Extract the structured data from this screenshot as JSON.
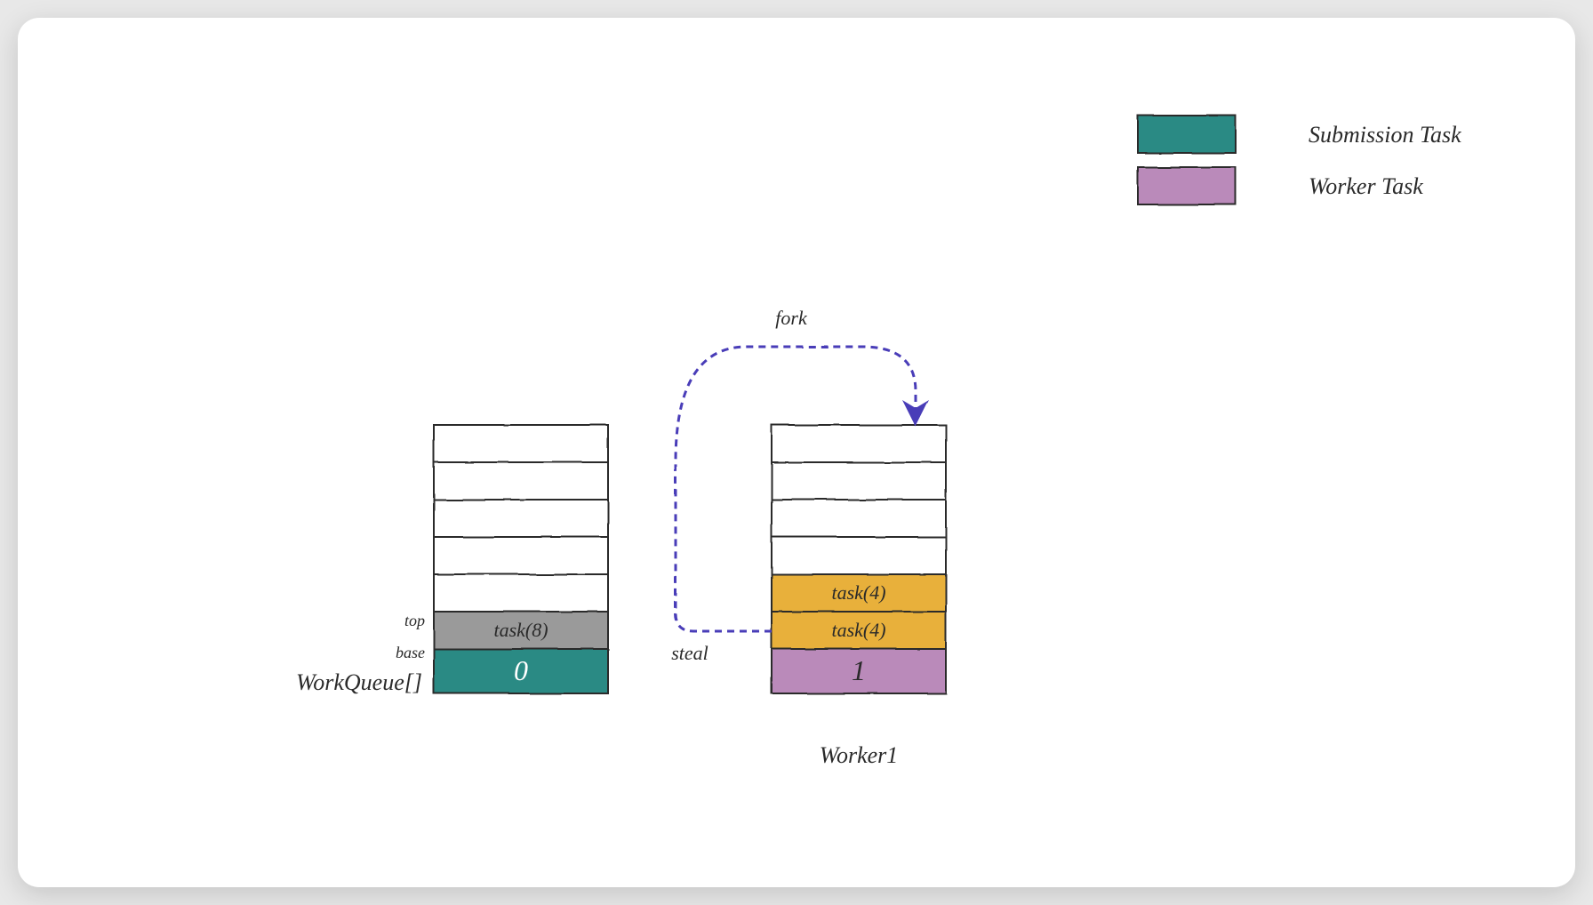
{
  "legend": {
    "item1": {
      "label": "Submission Task",
      "color": "#2b8a84"
    },
    "item2": {
      "label": "Worker Task",
      "color": "#ba8aba"
    }
  },
  "arrows": {
    "fork": "fork",
    "steal": "steal"
  },
  "leftQueue": {
    "sideLabels": {
      "top": "top",
      "base": "base"
    },
    "task": "task(8)",
    "baseIndex": "0",
    "arrayLabel": "WorkQueue[]"
  },
  "rightQueue": {
    "taskA": "task(4)",
    "taskB": "task(4)",
    "baseIndex": "1",
    "workerLabel": "Worker1"
  },
  "colors": {
    "teal": "#2b8a84",
    "purple": "#ba8aba",
    "gold": "#e8b03a",
    "gray": "#9a9a9a",
    "stroke": "#2a2a2a",
    "arrow": "#4a3cb8"
  }
}
